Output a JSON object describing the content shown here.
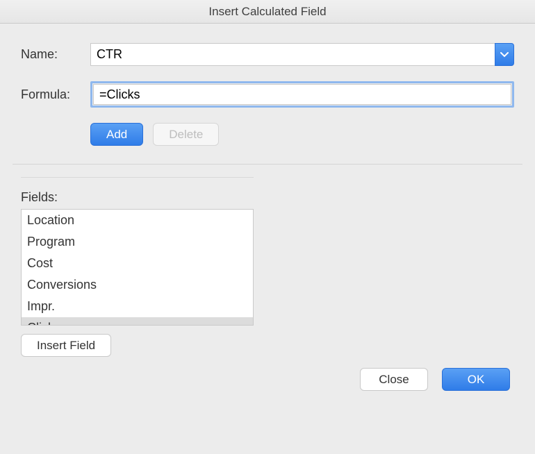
{
  "dialog": {
    "title": "Insert Calculated Field"
  },
  "labels": {
    "name": "Name:",
    "formula": "Formula:",
    "fields": "Fields:"
  },
  "inputs": {
    "name_value": "CTR",
    "formula_value": "=Clicks"
  },
  "buttons": {
    "add": "Add",
    "delete": "Delete",
    "insert_field": "Insert Field",
    "close": "Close",
    "ok": "OK"
  },
  "fields": {
    "items": [
      {
        "label": "Location"
      },
      {
        "label": "Program"
      },
      {
        "label": "Cost"
      },
      {
        "label": "Conversions"
      },
      {
        "label": "Impr."
      },
      {
        "label": "Clicks"
      }
    ],
    "selected_index": 5
  }
}
